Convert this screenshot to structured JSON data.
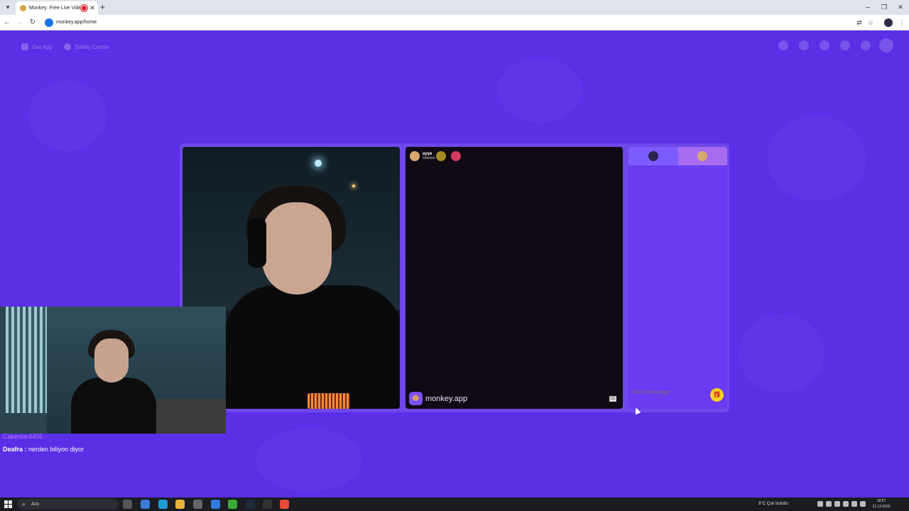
{
  "browser": {
    "tab_title": "Monkey: Free Live Video Ch",
    "url": "monkey.app/home"
  },
  "topnav": {
    "get_app": "Get App",
    "safety": "Safety Centre"
  },
  "match": {
    "user": "ayşe",
    "location": "İstanbul"
  },
  "brand": {
    "name": "monkey.app"
  },
  "chat": {
    "placeholder": "Send Message"
  },
  "overlay": {
    "line1": "Cakestar4455 :",
    "line2_user": "Deafra :",
    "line2_msg": " nerden biliyon diyor"
  },
  "taskbar": {
    "search": "Ara",
    "weather": "9°C  Çok bulutlu",
    "time": "18:57",
    "date": "21.12.2025"
  },
  "colors": {
    "page_bg": "#5a2fe6",
    "chat_bg": "#6a3bf0",
    "gift": "#f7d21a"
  }
}
